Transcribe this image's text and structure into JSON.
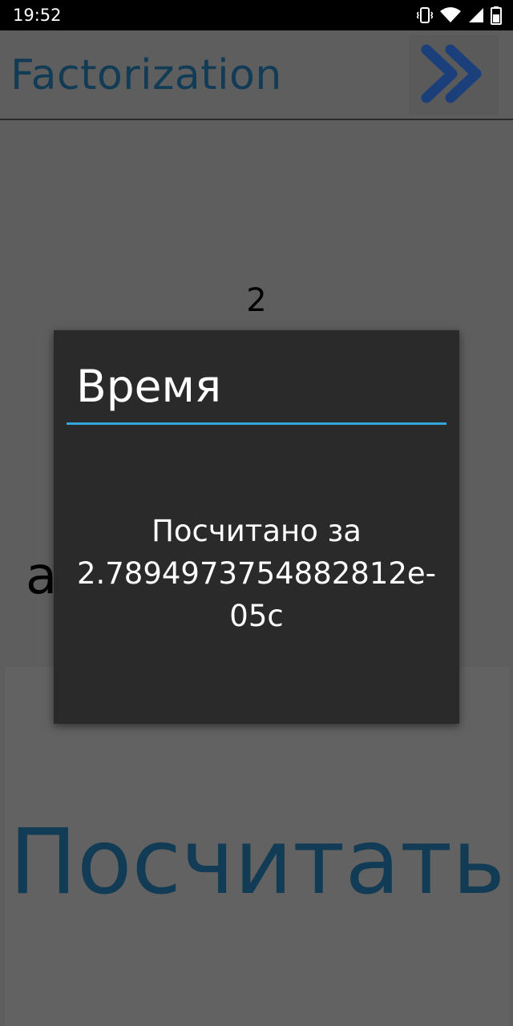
{
  "status_bar": {
    "time": "19:52",
    "icons": [
      "vibrate-icon",
      "wifi-icon",
      "signal-icon",
      "battery-icon"
    ]
  },
  "app_bar": {
    "title": "Factorization",
    "next_icon": "double-chevron-right-icon",
    "accent_color": "#123b55"
  },
  "main": {
    "result_value": "2",
    "input_letter": "a",
    "calculate_button_label": "Посчитать"
  },
  "dialog": {
    "title": "Время",
    "message_lines": [
      "Посчитано за",
      "2.789497375488281​2e-",
      "05с"
    ],
    "divider_color": "#33a6dc"
  }
}
